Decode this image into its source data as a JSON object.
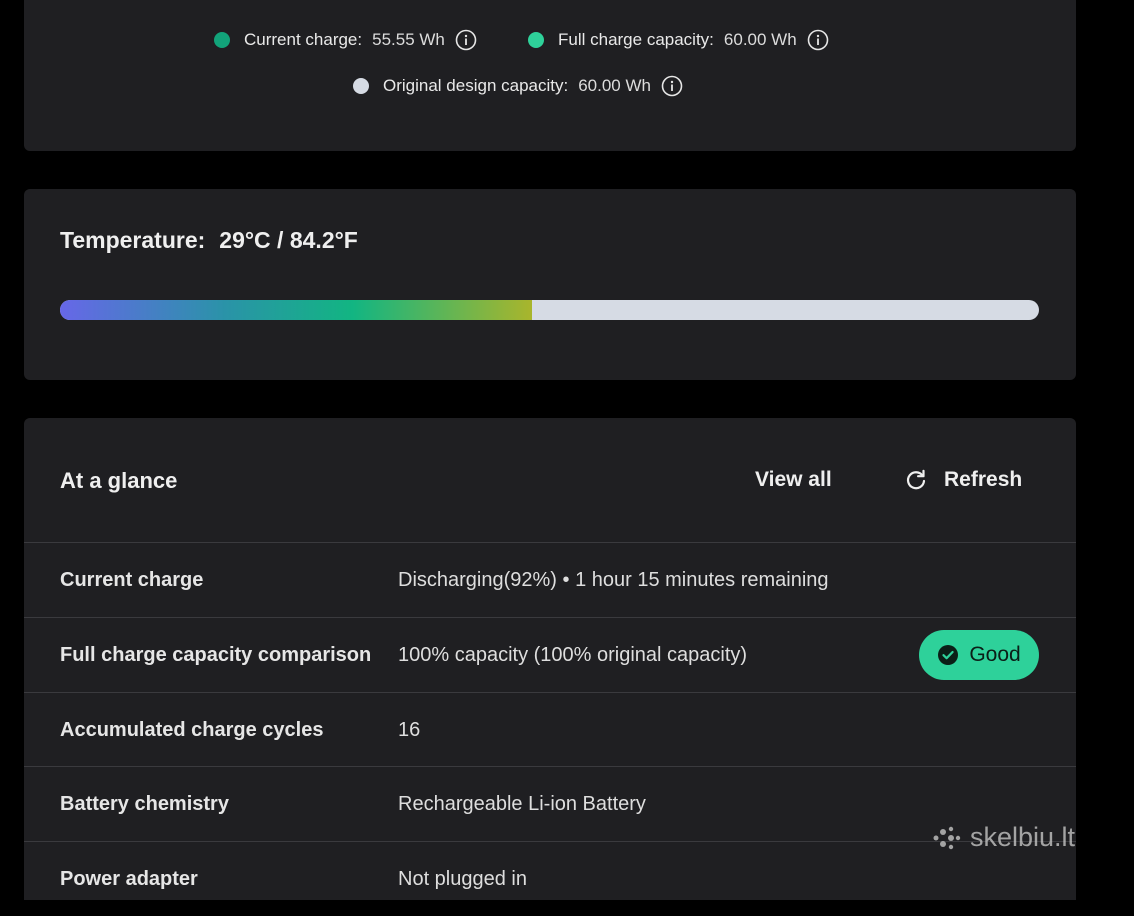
{
  "legend": {
    "current_charge": {
      "label": "Current charge:",
      "value": "55.55 Wh",
      "color": "#12a37a"
    },
    "full_charge_capacity": {
      "label": "Full charge capacity:",
      "value": "60.00 Wh",
      "color": "#2ed19a"
    },
    "original_design_capacity": {
      "label": "Original design capacity:",
      "value": "60.00 Wh",
      "color": "#d6dbe4"
    }
  },
  "temperature": {
    "label": "Temperature:",
    "value": "29°C / 84.2°F",
    "level_fraction": 0.482
  },
  "glance": {
    "title": "At a glance",
    "view_all": "View all",
    "refresh": "Refresh",
    "rows": [
      {
        "label": "Current charge",
        "value": "Discharging(92%)  •  1 hour 15 minutes remaining"
      },
      {
        "label": "Full charge capacity comparison",
        "value": "100% capacity (100% original capacity)",
        "badge": "Good"
      },
      {
        "label": "Accumulated charge cycles",
        "value": "16"
      },
      {
        "label": "Battery chemistry",
        "value": "Rechargeable Li-ion Battery"
      },
      {
        "label": "Power adapter",
        "value": "Not plugged in"
      }
    ]
  },
  "watermark": {
    "text": "skelbiu.lt"
  },
  "colors": {
    "badge_good": "#2ed19a",
    "card_bg": "#1f1f22"
  }
}
